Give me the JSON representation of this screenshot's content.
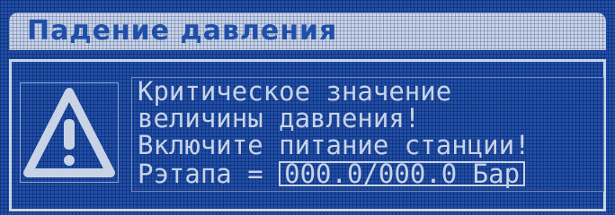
{
  "window": {
    "title": "Падение давления"
  },
  "message": {
    "line1": "Критическое значение",
    "line2": "величины давления!",
    "line3": "Включите питание станции!",
    "pressure_label": "Рэтапа = ",
    "pressure_value": "000.0/000.0 Бар"
  },
  "icons": {
    "warning": "warning-triangle"
  },
  "colors": {
    "background": "#1f4fa8",
    "foreground": "#c9d3e6"
  }
}
